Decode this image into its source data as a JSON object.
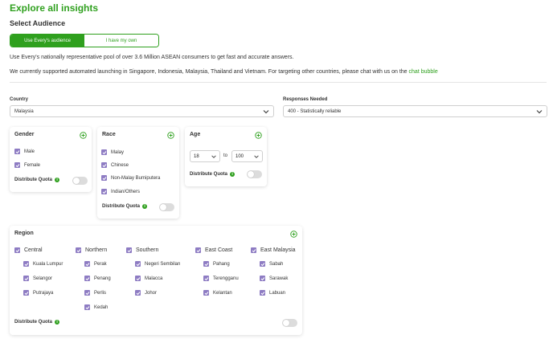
{
  "page": {
    "title": "Explore all insights",
    "subtitle": "Select Audience"
  },
  "audience_toggle": {
    "option1": "Use Every's audience",
    "option2": "I have my own",
    "selected": "Use Every's audience"
  },
  "info": {
    "line1": "Use Every's nationally representative pool of over 3.6 Million ASEAN consumers to get fast and accurate answers.",
    "line2": "We currently supported automated launching in Singapore, Indonesia, Malaysia, Thailand and Vietnam. For targeting other countries, please chat with us on the ",
    "link": "chat bubble"
  },
  "country": {
    "label": "Country",
    "value": "Malaysia"
  },
  "responses": {
    "label": "Responses Needed",
    "value": "400 - Statistically reliable"
  },
  "gender": {
    "title": "Gender",
    "options": [
      "Male",
      "Female"
    ],
    "distribute_label": "Distribute Quota"
  },
  "race": {
    "title": "Race",
    "options": [
      "Malay",
      "Chinese",
      "Non-Malay Bumiputera",
      "Indian/Others"
    ],
    "distribute_label": "Distribute Quota"
  },
  "age": {
    "title": "Age",
    "from": "18",
    "to_label": "to",
    "to": "100",
    "distribute_label": "Distribute Quota"
  },
  "region": {
    "title": "Region",
    "groups": [
      {
        "name": "Central",
        "items": [
          "Kuala Lumpur",
          "Selangor",
          "Putrajaya"
        ]
      },
      {
        "name": "Northern",
        "items": [
          "Perak",
          "Penang",
          "Perlis",
          "Kedah"
        ]
      },
      {
        "name": "Southern",
        "items": [
          "Negeri Sembilan",
          "Malacca",
          "Johor"
        ]
      },
      {
        "name": "East Coast",
        "items": [
          "Pahang",
          "Terengganu",
          "Kelantan"
        ]
      },
      {
        "name": "East Malaysia",
        "items": [
          "Sabah",
          "Sarawak",
          "Labuan"
        ]
      }
    ],
    "distribute_label": "Distribute Quota"
  },
  "colors": {
    "accent": "#2fa01e",
    "checkbox": "#8e7cc3"
  }
}
